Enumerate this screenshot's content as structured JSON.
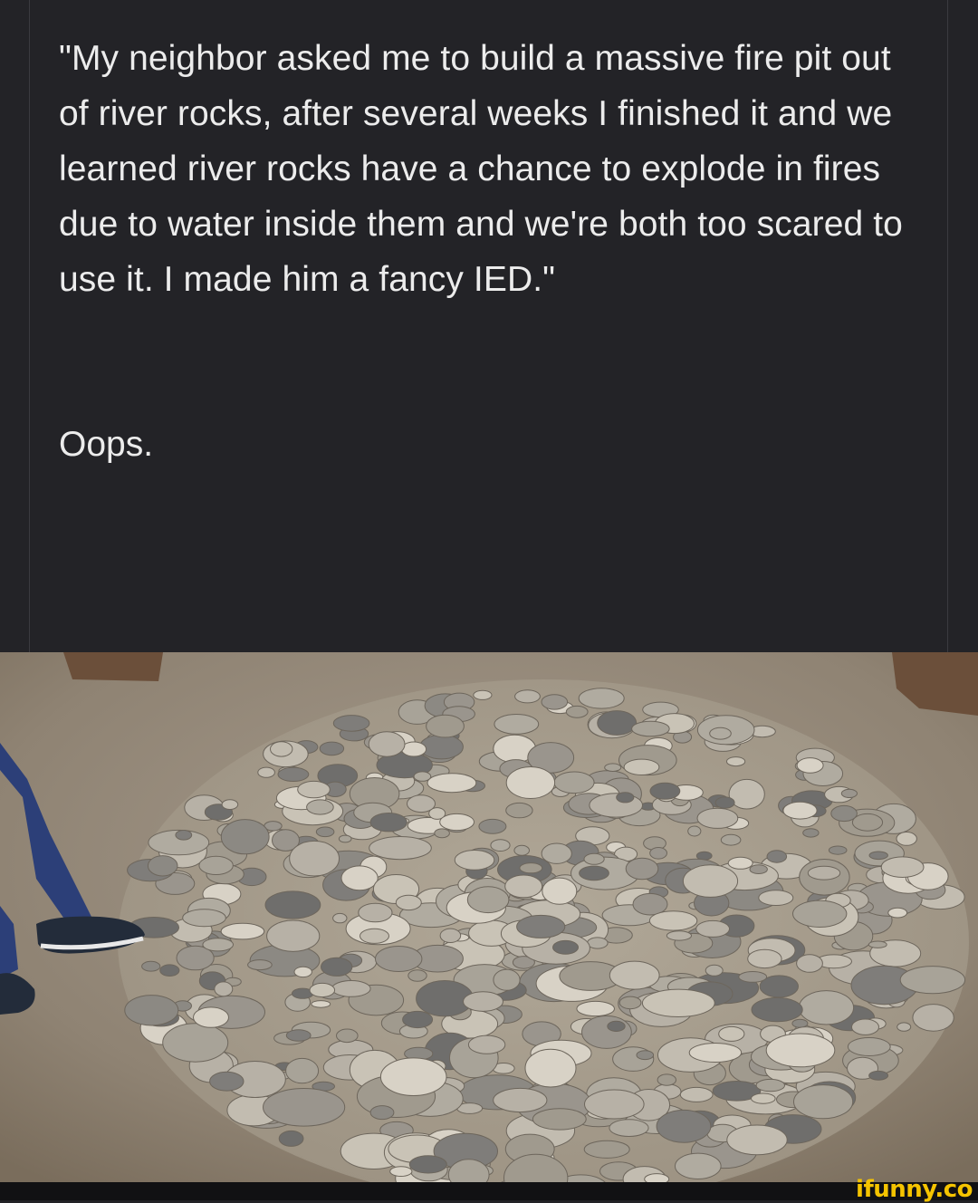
{
  "post": {
    "quote": "\"My neighbor asked me to build a massive fire pit out of river rocks, after several weeks I finished it and we learned river rocks have a chance to explode in fires due to water inside them and we're both too scared to use it. I made him a fancy IED.\"",
    "reply": "Oops."
  },
  "photo": {
    "subject": "river-rock-fire-pit"
  },
  "watermark": {
    "text": "ifunny.co",
    "color": "#f5c400"
  },
  "colors": {
    "background": "#232327",
    "text": "#ececec"
  }
}
